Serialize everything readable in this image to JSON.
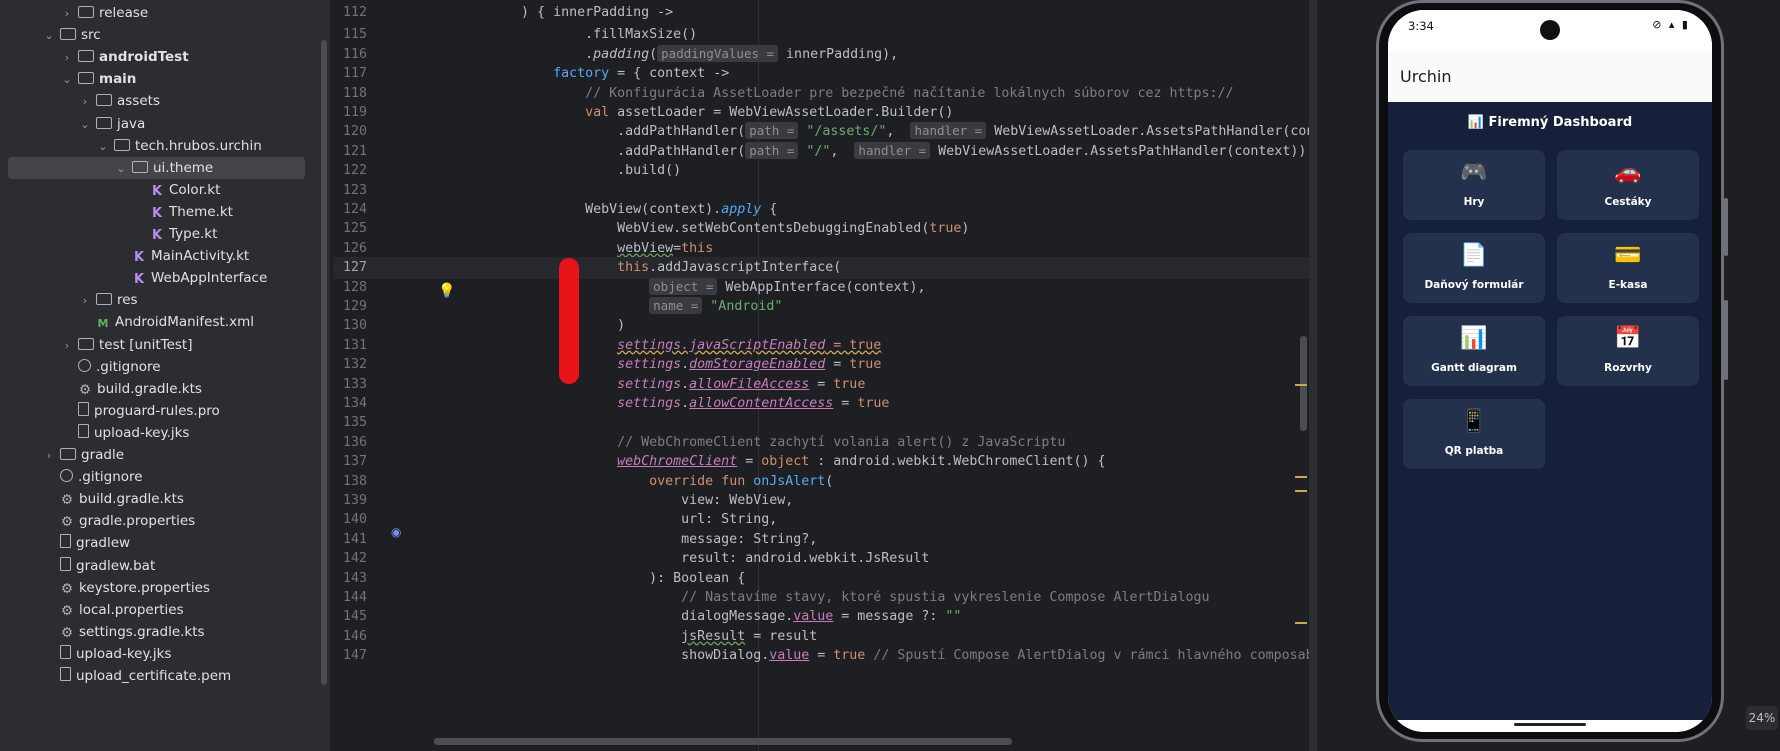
{
  "tree": [
    {
      "label": "release",
      "depth": 2,
      "chevron": "›",
      "icon": "folder",
      "bold": false
    },
    {
      "label": "src",
      "depth": 1,
      "chevron": "⌄",
      "icon": "folder",
      "bold": false
    },
    {
      "label": "androidTest",
      "depth": 2,
      "chevron": "›",
      "icon": "folder",
      "bold": true
    },
    {
      "label": "main",
      "depth": 2,
      "chevron": "⌄",
      "icon": "folder",
      "bold": true
    },
    {
      "label": "assets",
      "depth": 3,
      "chevron": "›",
      "icon": "folder",
      "bold": false
    },
    {
      "label": "java",
      "depth": 3,
      "chevron": "⌄",
      "icon": "folder",
      "bold": false
    },
    {
      "label": "tech.hrubos.urchin",
      "depth": 4,
      "chevron": "⌄",
      "icon": "folder",
      "bold": false
    },
    {
      "label": "ui.theme",
      "depth": 5,
      "chevron": "⌄",
      "icon": "folder",
      "bold": false,
      "selected": true
    },
    {
      "label": "Color.kt",
      "depth": 6,
      "chevron": "",
      "icon": "kt",
      "bold": false
    },
    {
      "label": "Theme.kt",
      "depth": 6,
      "chevron": "",
      "icon": "kt",
      "bold": false
    },
    {
      "label": "Type.kt",
      "depth": 6,
      "chevron": "",
      "icon": "kt",
      "bold": false
    },
    {
      "label": "MainActivity.kt",
      "depth": 5,
      "chevron": "",
      "icon": "kt",
      "bold": false
    },
    {
      "label": "WebAppInterface",
      "depth": 5,
      "chevron": "",
      "icon": "kt",
      "bold": false
    },
    {
      "label": "res",
      "depth": 3,
      "chevron": "›",
      "icon": "folder",
      "bold": false
    },
    {
      "label": "AndroidManifest.xml",
      "depth": 3,
      "chevron": "",
      "icon": "xml",
      "bold": false
    },
    {
      "label": "test [unitTest]",
      "depth": 2,
      "chevron": "›",
      "icon": "folder",
      "bold": false
    },
    {
      "label": ".gitignore",
      "depth": 2,
      "chevron": "",
      "icon": "ign",
      "bold": false
    },
    {
      "label": "build.gradle.kts",
      "depth": 2,
      "chevron": "",
      "icon": "gear",
      "bold": false
    },
    {
      "label": "proguard-rules.pro",
      "depth": 2,
      "chevron": "",
      "icon": "file",
      "bold": false
    },
    {
      "label": "upload-key.jks",
      "depth": 2,
      "chevron": "",
      "icon": "file",
      "bold": false
    },
    {
      "label": "gradle",
      "depth": 1,
      "chevron": "›",
      "icon": "folder",
      "bold": false
    },
    {
      "label": ".gitignore",
      "depth": 1,
      "chevron": "",
      "icon": "ign",
      "bold": false
    },
    {
      "label": "build.gradle.kts",
      "depth": 1,
      "chevron": "",
      "icon": "gear",
      "bold": false
    },
    {
      "label": "gradle.properties",
      "depth": 1,
      "chevron": "",
      "icon": "gear",
      "bold": false
    },
    {
      "label": "gradlew",
      "depth": 1,
      "chevron": "",
      "icon": "file",
      "bold": false
    },
    {
      "label": "gradlew.bat",
      "depth": 1,
      "chevron": "",
      "icon": "file",
      "bold": false
    },
    {
      "label": "keystore.properties",
      "depth": 1,
      "chevron": "",
      "icon": "gear",
      "bold": false
    },
    {
      "label": "local.properties",
      "depth": 1,
      "chevron": "",
      "icon": "gear",
      "bold": false
    },
    {
      "label": "settings.gradle.kts",
      "depth": 1,
      "chevron": "",
      "icon": "gear",
      "bold": false
    },
    {
      "label": "upload-key.jks",
      "depth": 1,
      "chevron": "",
      "icon": "file",
      "bold": false
    },
    {
      "label": "upload_certificate.pem",
      "depth": 1,
      "chevron": "",
      "icon": "file",
      "bold": false
    }
  ],
  "editor": {
    "current_line": "127",
    "lines": [
      {
        "n": "112",
        "segs": [
          {
            "t": "        ) { innerPadding ->",
            "c": ""
          }
        ]
      },
      {
        "n": "115",
        "segs": [
          {
            "t": "                .fillMaxSize()",
            "c": ""
          }
        ]
      },
      {
        "n": "116",
        "segs": [
          {
            "t": "                .",
            "c": ""
          },
          {
            "t": "padding",
            "c": "it"
          },
          {
            "t": "(",
            "c": ""
          },
          {
            "t": "paddingValues =",
            "c": "hint"
          },
          {
            "t": " innerPadding),",
            "c": ""
          }
        ]
      },
      {
        "n": "117",
        "segs": [
          {
            "t": "            ",
            "c": ""
          },
          {
            "t": "factory",
            "c": "fn"
          },
          {
            "t": " = { context ->",
            "c": ""
          }
        ]
      },
      {
        "n": "118",
        "segs": [
          {
            "t": "                // Konfigurácia AssetLoader pre bezpečné načítanie lokálnych súborov cez https://",
            "c": "cm"
          }
        ]
      },
      {
        "n": "119",
        "segs": [
          {
            "t": "                ",
            "c": ""
          },
          {
            "t": "val",
            "c": "kw"
          },
          {
            "t": " assetLoader = WebViewAssetLoader.Builder()",
            "c": ""
          }
        ]
      },
      {
        "n": "120",
        "segs": [
          {
            "t": "                    .addPathHandler(",
            "c": ""
          },
          {
            "t": "path =",
            "c": "hint"
          },
          {
            "t": " \"/assets/\"",
            "c": "str"
          },
          {
            "t": ",  ",
            "c": ""
          },
          {
            "t": "handler =",
            "c": "hint"
          },
          {
            "t": " WebViewAssetLoader.AssetsPathHandler(context))",
            "c": ""
          }
        ]
      },
      {
        "n": "121",
        "segs": [
          {
            "t": "                    .addPathHandler(",
            "c": ""
          },
          {
            "t": "path =",
            "c": "hint"
          },
          {
            "t": " \"/\"",
            "c": "str"
          },
          {
            "t": ",  ",
            "c": ""
          },
          {
            "t": "handler =",
            "c": "hint"
          },
          {
            "t": " WebViewAssetLoader.AssetsPathHandler(context))",
            "c": ""
          }
        ]
      },
      {
        "n": "122",
        "segs": [
          {
            "t": "                    .build()",
            "c": ""
          }
        ]
      },
      {
        "n": "123",
        "segs": [
          {
            "t": "",
            "c": ""
          }
        ]
      },
      {
        "n": "124",
        "segs": [
          {
            "t": "                WebView(context).",
            "c": ""
          },
          {
            "t": "apply",
            "c": "fn it"
          },
          {
            "t": " {",
            "c": ""
          }
        ]
      },
      {
        "n": "125",
        "segs": [
          {
            "t": "                    WebView.setWebContentsDebuggingEnabled(",
            "c": ""
          },
          {
            "t": "true",
            "c": "kw"
          },
          {
            "t": ")",
            "c": ""
          }
        ]
      },
      {
        "n": "126",
        "segs": [
          {
            "t": "                    ",
            "c": ""
          },
          {
            "t": "webView",
            "c": "ulw"
          },
          {
            "t": "=",
            "c": ""
          },
          {
            "t": "this",
            "c": "kw"
          }
        ]
      },
      {
        "n": "127",
        "segs": [
          {
            "t": "                    ",
            "c": ""
          },
          {
            "t": "this",
            "c": "kw"
          },
          {
            "t": ".addJavascriptInterface(",
            "c": ""
          }
        ]
      },
      {
        "n": "128",
        "segs": [
          {
            "t": "                        ",
            "c": ""
          },
          {
            "t": "object =",
            "c": "hint"
          },
          {
            "t": " WebAppInterface(context),",
            "c": ""
          }
        ]
      },
      {
        "n": "129",
        "segs": [
          {
            "t": "                        ",
            "c": ""
          },
          {
            "t": "name =",
            "c": "hint"
          },
          {
            "t": " \"Android\"",
            "c": "str"
          }
        ]
      },
      {
        "n": "130",
        "segs": [
          {
            "t": "                    )",
            "c": ""
          }
        ]
      },
      {
        "n": "131",
        "segs": [
          {
            "t": "                    ",
            "c": ""
          },
          {
            "t": "settings.javaScriptEnabled",
            "c": "prop it yw"
          },
          {
            "t": " = true",
            "c": "kw yw"
          }
        ]
      },
      {
        "n": "132",
        "segs": [
          {
            "t": "                    ",
            "c": ""
          },
          {
            "t": "settings",
            "c": "prop it"
          },
          {
            "t": ".",
            "c": ""
          },
          {
            "t": "domStorageEnabled",
            "c": "prop it ul"
          },
          {
            "t": " = ",
            "c": ""
          },
          {
            "t": "true",
            "c": "kw"
          }
        ]
      },
      {
        "n": "133",
        "segs": [
          {
            "t": "                    ",
            "c": ""
          },
          {
            "t": "settings",
            "c": "prop it"
          },
          {
            "t": ".",
            "c": ""
          },
          {
            "t": "allowFileAccess",
            "c": "prop it ul"
          },
          {
            "t": " = ",
            "c": ""
          },
          {
            "t": "true",
            "c": "kw"
          }
        ]
      },
      {
        "n": "134",
        "segs": [
          {
            "t": "                    ",
            "c": ""
          },
          {
            "t": "settings",
            "c": "prop it"
          },
          {
            "t": ".",
            "c": ""
          },
          {
            "t": "allowContentAccess",
            "c": "prop it ul"
          },
          {
            "t": " = ",
            "c": ""
          },
          {
            "t": "true",
            "c": "kw"
          }
        ]
      },
      {
        "n": "135",
        "segs": [
          {
            "t": "",
            "c": ""
          }
        ]
      },
      {
        "n": "136",
        "segs": [
          {
            "t": "                    // WebChromeClient zachytí volania alert() z JavaScriptu",
            "c": "cm"
          }
        ]
      },
      {
        "n": "137",
        "segs": [
          {
            "t": "                    ",
            "c": ""
          },
          {
            "t": "webChromeClient",
            "c": "prop it ul"
          },
          {
            "t": " = ",
            "c": ""
          },
          {
            "t": "object",
            "c": "kw"
          },
          {
            "t": " : android.webkit.WebChromeClient() {",
            "c": ""
          }
        ]
      },
      {
        "n": "138",
        "segs": [
          {
            "t": "                        ",
            "c": ""
          },
          {
            "t": "override fun",
            "c": "kw"
          },
          {
            "t": " ",
            "c": ""
          },
          {
            "t": "onJsAlert",
            "c": "fn"
          },
          {
            "t": "(",
            "c": ""
          }
        ]
      },
      {
        "n": "139",
        "segs": [
          {
            "t": "                            view: WebView,",
            "c": ""
          }
        ]
      },
      {
        "n": "140",
        "segs": [
          {
            "t": "                            url: String,",
            "c": ""
          }
        ]
      },
      {
        "n": "141",
        "segs": [
          {
            "t": "                            message: String?,",
            "c": ""
          }
        ]
      },
      {
        "n": "142",
        "segs": [
          {
            "t": "                            result: android.webkit.JsResult",
            "c": ""
          }
        ]
      },
      {
        "n": "143",
        "segs": [
          {
            "t": "                        ): Boolean {",
            "c": ""
          }
        ]
      },
      {
        "n": "144",
        "segs": [
          {
            "t": "                            // Nastavíme stavy, ktoré spustia vykreslenie Compose AlertDialogu",
            "c": "cm"
          }
        ]
      },
      {
        "n": "145",
        "segs": [
          {
            "t": "                            dialogMessage.",
            "c": ""
          },
          {
            "t": "value",
            "c": "prop ul"
          },
          {
            "t": " = message ?: ",
            "c": ""
          },
          {
            "t": "\"\"",
            "c": "str"
          }
        ]
      },
      {
        "n": "146",
        "segs": [
          {
            "t": "                            ",
            "c": ""
          },
          {
            "t": "jsResult",
            "c": "ulw"
          },
          {
            "t": " = result",
            "c": ""
          }
        ]
      },
      {
        "n": "147",
        "segs": [
          {
            "t": "                            showDialog.",
            "c": ""
          },
          {
            "t": "value",
            "c": "prop ul"
          },
          {
            "t": " = ",
            "c": ""
          },
          {
            "t": "true",
            "c": "kw"
          },
          {
            "t": " // Spustí Compose AlertDialog v rámci hlavného composable",
            "c": "cm"
          }
        ]
      }
    ]
  },
  "phone": {
    "time": "3:34",
    "status_icons": "⊘ ▴ ▮",
    "app_title": "Urchin",
    "dashboard_title": "📊 Firemný Dashboard",
    "cards": [
      {
        "icon": "🎮",
        "label": "Hry"
      },
      {
        "icon": "🚗",
        "label": "Cestáky"
      },
      {
        "icon": "📄",
        "label": "Daňový formulár"
      },
      {
        "icon": "💳",
        "label": "E-kasa"
      },
      {
        "icon": "📊",
        "label": "Gantt diagram"
      },
      {
        "icon": "📅",
        "label": "Rozvrhy"
      },
      {
        "icon": "📱",
        "label": "QR platba"
      }
    ]
  },
  "zoom": "24%",
  "colors": {
    "accent_warning": "#c9a94a",
    "redaction": "#e8141a",
    "web_bg": "#16203a",
    "card_bg": "#24314d"
  }
}
